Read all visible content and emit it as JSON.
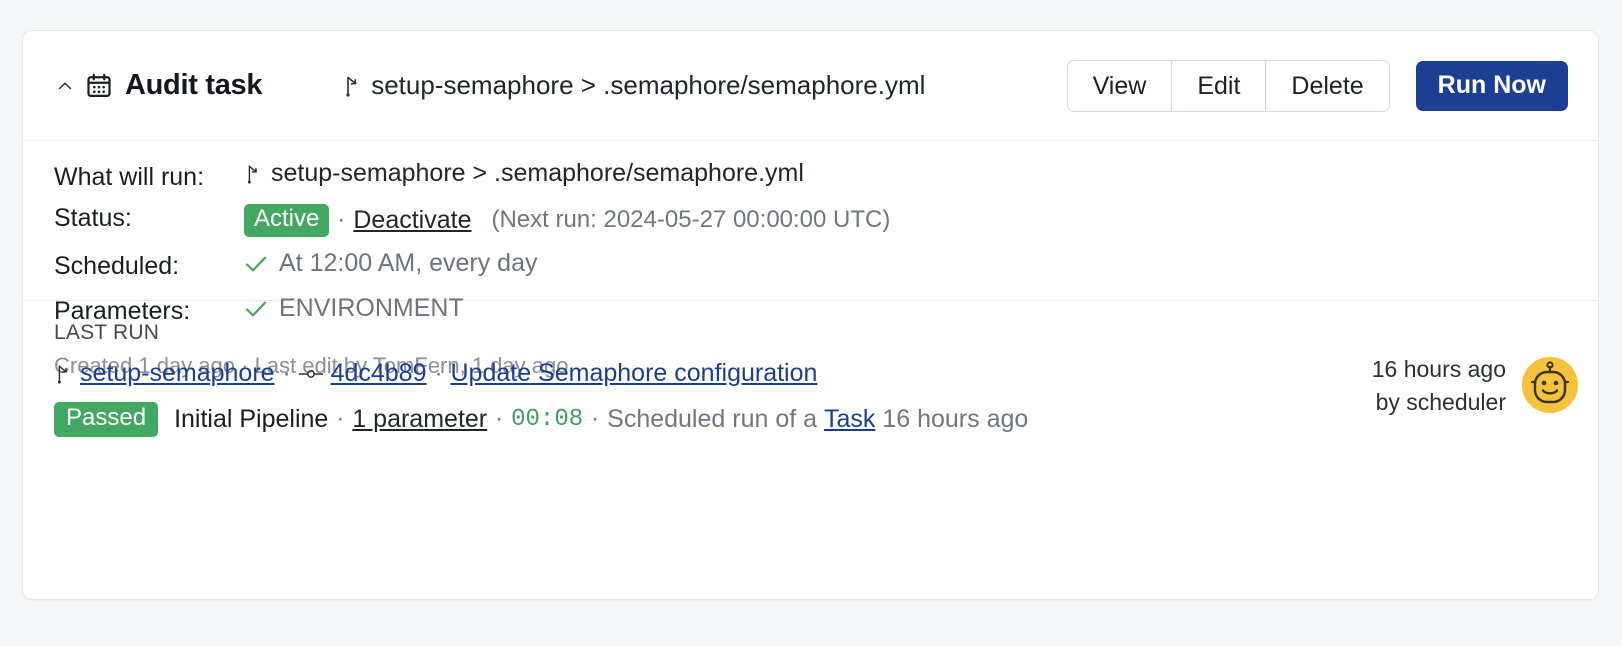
{
  "header": {
    "collapse_icon": "chevron-up-icon",
    "calendar_icon": "calendar-icon",
    "title": "Audit task",
    "branch_icon": "git-branch-icon",
    "path": "setup-semaphore > .semaphore/semaphore.yml",
    "buttons": {
      "view": "View",
      "edit": "Edit",
      "delete": "Delete",
      "run_now": "Run Now"
    }
  },
  "details": {
    "what_will_run_label": "What will run:",
    "what_will_run_value": "setup-semaphore > .semaphore/semaphore.yml",
    "status_label": "Status:",
    "status_badge": "Active",
    "status_separator": "·",
    "deactivate_link": "Deactivate",
    "next_run": "(Next run: 2024-05-27 00:00:00 UTC)",
    "scheduled_label": "Scheduled:",
    "scheduled_value": "At 12:00 AM, every day",
    "parameters_label": "Parameters:",
    "parameters_value": "ENVIRONMENT",
    "created_line": "Created 1 day ago · Last edit by TomFern, 1 day ago"
  },
  "last_run": {
    "section_title": "LAST RUN",
    "branch_icon": "git-branch-icon",
    "branch_link": "setup-semaphore",
    "sep1": "·",
    "commit_icon": "git-commit-icon",
    "commit_link": "4dc4b89",
    "sep2": "·",
    "commit_message_link": "Update Semaphore configuration",
    "status_badge": "Passed",
    "pipeline_name": "Initial Pipeline",
    "sep3": "·",
    "parameters_link": "1 parameter",
    "sep4": "·",
    "duration": "00:08",
    "sep5": "·",
    "trigger_prefix": "Scheduled run of a",
    "trigger_link": "Task",
    "trigger_suffix": "16 hours ago",
    "meta_time": "16 hours ago",
    "meta_author": "by scheduler",
    "avatar_icon": "robot-avatar-icon"
  },
  "colors": {
    "primary_button": "#1c3f94",
    "success_green": "#42a862",
    "link_blue": "#1b3f8f",
    "duration_green": "#3f9e63",
    "avatar_yellow": "#f5c33b",
    "page_background": "#f4f6f8"
  }
}
